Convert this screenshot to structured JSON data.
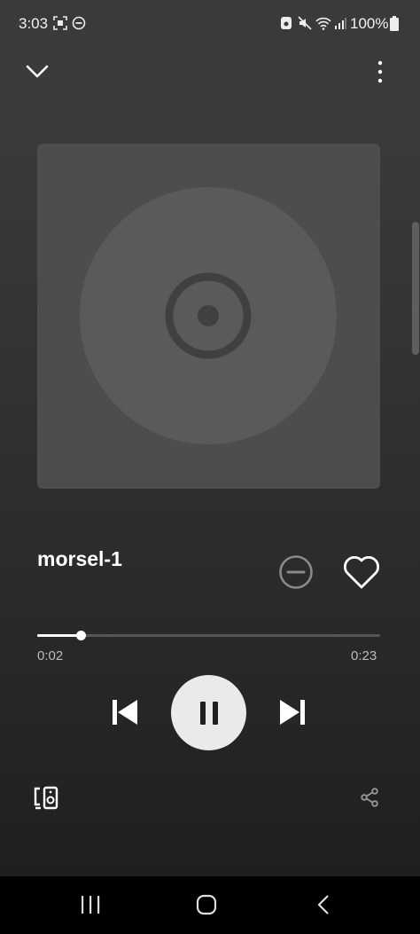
{
  "status_bar": {
    "time": "3:03",
    "battery": "100%"
  },
  "track": {
    "title": "morsel-1",
    "elapsed": "0:02",
    "duration": "0:23",
    "progress_fraction": 0.127
  },
  "icons": {
    "collapse": "chevron-down-icon",
    "menu": "more-vertical-icon",
    "album_art": "disc-placeholder-icon",
    "hide": "minus-circle-icon",
    "like": "heart-icon",
    "previous": "skip-previous-icon",
    "pause": "pause-icon",
    "next": "skip-next-icon",
    "devices": "connect-device-icon",
    "share": "share-icon"
  },
  "colors": {
    "accent": "#ffffff",
    "art_background": "#4d4d4d",
    "disc": "#5a5a5a"
  }
}
